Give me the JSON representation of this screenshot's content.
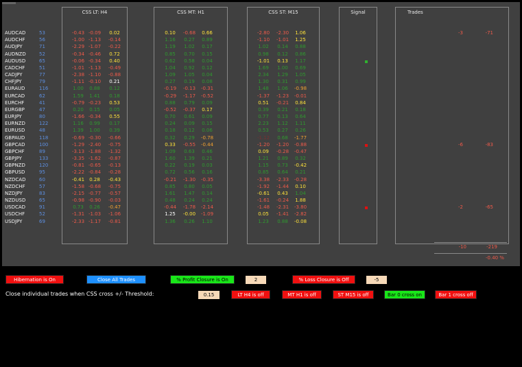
{
  "headers": {
    "lt": "CSS LT:  H4",
    "mt": "CSS MT:  H1",
    "st": "CSS ST:  M15",
    "signal": "Signal",
    "trades": "Trades"
  },
  "colors": {
    "pos": "#b8e85a",
    "neg": "#ef5a4a",
    "dimPos": "#2f9a2f",
    "dimNeg": "#7a2f2f",
    "yellow": "#ffe23a",
    "orange": "#f0a030",
    "white": "#ffffff",
    "signalGreen": "#2fb32f",
    "signalRed": "#e01010"
  },
  "rows": [
    {
      "sym": "AUDCAD",
      "idx": "53",
      "lt": [
        [
          "-0.43",
          "neg"
        ],
        [
          "-0.09",
          "neg"
        ],
        [
          "0.02",
          "yellow"
        ]
      ],
      "mt": [
        [
          "0.10",
          "yellow"
        ],
        [
          "-0.68",
          "neg"
        ],
        [
          "0.66",
          "yellow"
        ]
      ],
      "st": [
        [
          "-2.80",
          "neg"
        ],
        [
          "-2.30",
          "neg"
        ],
        [
          "1.06",
          "yellow"
        ]
      ]
    },
    {
      "sym": "AUDCHF",
      "idx": "56",
      "lt": [
        [
          "-1.00",
          "neg"
        ],
        [
          "-1.13",
          "neg"
        ],
        [
          "-0.14",
          "neg"
        ]
      ],
      "mt": [
        [
          "1.16",
          "dimPos"
        ],
        [
          "0.27",
          "dimPos"
        ],
        [
          "0.89",
          "dimPos"
        ]
      ],
      "st": [
        [
          "-1.10",
          "neg"
        ],
        [
          "-1.01",
          "neg"
        ],
        [
          "1.25",
          "yellow"
        ]
      ]
    },
    {
      "sym": "AUDJPY",
      "idx": "71",
      "lt": [
        [
          "-2.29",
          "neg"
        ],
        [
          "-1.07",
          "neg"
        ],
        [
          "-0.22",
          "neg"
        ]
      ],
      "mt": [
        [
          "1.19",
          "dimPos"
        ],
        [
          "1.02",
          "dimPos"
        ],
        [
          "0.17",
          "dimPos"
        ]
      ],
      "st": [
        [
          "1.02",
          "dimPos"
        ],
        [
          "0.14",
          "dimPos"
        ],
        [
          "0.88",
          "dimPos"
        ]
      ]
    },
    {
      "sym": "AUDNZD",
      "idx": "52",
      "lt": [
        [
          "-0.34",
          "neg"
        ],
        [
          "-0.46",
          "neg"
        ],
        [
          "0.72",
          "yellow"
        ]
      ],
      "mt": [
        [
          "0.85",
          "dimPos"
        ],
        [
          "0.70",
          "dimPos"
        ],
        [
          "0.15",
          "dimPos"
        ]
      ],
      "st": [
        [
          "0.98",
          "dimPos"
        ],
        [
          "0.12",
          "dimPos"
        ],
        [
          "0.86",
          "dimPos"
        ]
      ]
    },
    {
      "sym": "AUDUSD",
      "idx": "65",
      "lt": [
        [
          "-0.06",
          "neg"
        ],
        [
          "-0.34",
          "neg"
        ],
        [
          "0.40",
          "yellow"
        ]
      ],
      "mt": [
        [
          "0.62",
          "dimPos"
        ],
        [
          "0.58",
          "dimPos"
        ],
        [
          "0.04",
          "dimPos"
        ]
      ],
      "st": [
        [
          "-1.01",
          "yellow"
        ],
        [
          "0.13",
          "yellow"
        ],
        [
          "1.17",
          "dimPos"
        ]
      ]
    },
    {
      "sym": "CADCHF",
      "idx": "51",
      "lt": [
        [
          "-1.01",
          "neg"
        ],
        [
          "-1.13",
          "neg"
        ],
        [
          "-0.49",
          "neg"
        ]
      ],
      "mt": [
        [
          "1.04",
          "dimPos"
        ],
        [
          "0.92",
          "dimPos"
        ],
        [
          "0.12",
          "dimPos"
        ]
      ],
      "st": [
        [
          "1.69",
          "dimPos"
        ],
        [
          "1.00",
          "dimPos"
        ],
        [
          "0.69",
          "dimPos"
        ]
      ]
    },
    {
      "sym": "CADJPY",
      "idx": "77",
      "lt": [
        [
          "-2.38",
          "neg"
        ],
        [
          "-1.10",
          "neg"
        ],
        [
          "-0.88",
          "neg"
        ]
      ],
      "mt": [
        [
          "1.09",
          "dimPos"
        ],
        [
          "1.05",
          "dimPos"
        ],
        [
          "0.04",
          "dimPos"
        ]
      ],
      "st": [
        [
          "2.34",
          "dimPos"
        ],
        [
          "1.29",
          "dimPos"
        ],
        [
          "1.05",
          "dimPos"
        ]
      ]
    },
    {
      "sym": "CHFJPY",
      "idx": "79",
      "lt": [
        [
          "-1.11",
          "neg"
        ],
        [
          "-0.10",
          "neg"
        ],
        [
          "0.21",
          "white"
        ]
      ],
      "mt": [
        [
          "0.27",
          "dimPos"
        ],
        [
          "0.19",
          "dimPos"
        ],
        [
          "0.08",
          "dimPos"
        ]
      ],
      "st": [
        [
          "1.30",
          "dimPos"
        ],
        [
          "0.31",
          "dimPos"
        ],
        [
          "0.99",
          "dimPos"
        ]
      ]
    },
    {
      "sym": "EURAUD",
      "idx": "116",
      "lt": [
        [
          "1.00",
          "dimPos"
        ],
        [
          "0.88",
          "dimPos"
        ],
        [
          "0.12",
          "dimPos"
        ]
      ],
      "mt": [
        [
          "-0.19",
          "neg"
        ],
        [
          "-0.13",
          "neg"
        ],
        [
          "-0.31",
          "neg"
        ]
      ],
      "st": [
        [
          "1.48",
          "dimPos"
        ],
        [
          "1.06",
          "dimPos"
        ],
        [
          "-0.98",
          "orange"
        ]
      ]
    },
    {
      "sym": "EURCAD",
      "idx": "62",
      "lt": [
        [
          "1.59",
          "dimPos"
        ],
        [
          "1.41",
          "dimPos"
        ],
        [
          "0.18",
          "dimPos"
        ]
      ],
      "mt": [
        [
          "-0.29",
          "neg"
        ],
        [
          "-1.17",
          "neg"
        ],
        [
          "-0.52",
          "neg"
        ]
      ],
      "st": [
        [
          "-1.37",
          "neg"
        ],
        [
          "-1.23",
          "neg"
        ],
        [
          "-0.01",
          "neg"
        ]
      ]
    },
    {
      "sym": "EURCHF",
      "idx": "41",
      "lt": [
        [
          "-0.79",
          "neg"
        ],
        [
          "-0.23",
          "neg"
        ],
        [
          "0.53",
          "yellow"
        ]
      ],
      "mt": [
        [
          "0.88",
          "dimPos"
        ],
        [
          "0.79",
          "dimPos"
        ],
        [
          "0.09",
          "dimPos"
        ]
      ],
      "st": [
        [
          "0.51",
          "yellow"
        ],
        [
          "-0.21",
          "neg"
        ],
        [
          "0.84",
          "yellow"
        ]
      ]
    },
    {
      "sym": "EURGBP",
      "idx": "47",
      "lt": [
        [
          "0.20",
          "dimPos"
        ],
        [
          "0.15",
          "dimPos"
        ],
        [
          "0.05",
          "dimPos"
        ]
      ],
      "mt": [
        [
          "-0.52",
          "neg"
        ],
        [
          "-0.37",
          "neg"
        ],
        [
          "0.17",
          "yellow"
        ]
      ],
      "st": [
        [
          "0.39",
          "dimPos"
        ],
        [
          "0.21",
          "dimPos"
        ],
        [
          "0.18",
          "dimPos"
        ]
      ]
    },
    {
      "sym": "EURJPY",
      "idx": "80",
      "lt": [
        [
          "-1.66",
          "neg"
        ],
        [
          "-0.34",
          "neg"
        ],
        [
          "0.55",
          "yellow"
        ]
      ],
      "mt": [
        [
          "0.70",
          "dimPos"
        ],
        [
          "0.61",
          "dimPos"
        ],
        [
          "0.09",
          "dimPos"
        ]
      ],
      "st": [
        [
          "0.77",
          "dimPos"
        ],
        [
          "0.13",
          "dimPos"
        ],
        [
          "0.64",
          "dimPos"
        ]
      ]
    },
    {
      "sym": "EURNZD",
      "idx": "122",
      "lt": [
        [
          "1.16",
          "dimPos"
        ],
        [
          "0.99",
          "dimPos"
        ],
        [
          "0.17",
          "dimPos"
        ]
      ],
      "mt": [
        [
          "0.24",
          "dimPos"
        ],
        [
          "0.09",
          "dimPos"
        ],
        [
          "0.15",
          "dimPos"
        ]
      ],
      "st": [
        [
          "2.23",
          "dimPos"
        ],
        [
          "1.12",
          "dimPos"
        ],
        [
          "1.11",
          "dimPos"
        ]
      ]
    },
    {
      "sym": "EURUSD",
      "idx": "48",
      "lt": [
        [
          "1.39",
          "dimPos"
        ],
        [
          "1.00",
          "dimPos"
        ],
        [
          "0.39",
          "dimPos"
        ]
      ],
      "mt": [
        [
          "0.18",
          "dimPos"
        ],
        [
          "0.12",
          "dimPos"
        ],
        [
          "0.06",
          "dimPos"
        ]
      ],
      "st": [
        [
          "0.53",
          "dimPos"
        ],
        [
          "0.27",
          "dimPos"
        ],
        [
          "0.26",
          "dimPos"
        ]
      ]
    },
    {
      "sym": "GBPAUD",
      "idx": "118",
      "lt": [
        [
          "-0.69",
          "neg"
        ],
        [
          "-0.30",
          "neg"
        ],
        [
          "-0.66",
          "neg"
        ]
      ],
      "mt": [
        [
          "0.32",
          "dimPos"
        ],
        [
          "0.29",
          "dimPos"
        ],
        [
          "-0.78",
          "orange"
        ]
      ],
      "st": [
        [
          "-1.12",
          "dimNeg"
        ],
        [
          "0.68",
          "dimPos"
        ],
        [
          "-1.77",
          "orange"
        ]
      ]
    },
    {
      "sym": "GBPCAD",
      "idx": "100",
      "lt": [
        [
          "-1.29",
          "neg"
        ],
        [
          "-2.40",
          "neg"
        ],
        [
          "-0.75",
          "neg"
        ]
      ],
      "mt": [
        [
          "0.33",
          "yellow"
        ],
        [
          "-0.55",
          "neg"
        ],
        [
          "-0.44",
          "orange"
        ]
      ],
      "st": [
        [
          "-1.20",
          "neg"
        ],
        [
          "-1.20",
          "neg"
        ],
        [
          "-0.88",
          "neg"
        ]
      ]
    },
    {
      "sym": "GBPCHF",
      "idx": "89",
      "lt": [
        [
          "-3.13",
          "neg"
        ],
        [
          "-1.88",
          "neg"
        ],
        [
          "-1.32",
          "neg"
        ]
      ],
      "mt": [
        [
          "1.09",
          "dimPos"
        ],
        [
          "0.63",
          "dimPos"
        ],
        [
          "0.46",
          "dimPos"
        ]
      ],
      "st": [
        [
          "0.09",
          "yellow"
        ],
        [
          "-0.28",
          "neg"
        ],
        [
          "-0.47",
          "neg"
        ]
      ]
    },
    {
      "sym": "GBPJPY",
      "idx": "133",
      "lt": [
        [
          "-3.35",
          "neg"
        ],
        [
          "-1.62",
          "neg"
        ],
        [
          "-0.87",
          "neg"
        ]
      ],
      "mt": [
        [
          "1.60",
          "dimPos"
        ],
        [
          "1.39",
          "dimPos"
        ],
        [
          "0.21",
          "dimPos"
        ]
      ],
      "st": [
        [
          "1.21",
          "dimPos"
        ],
        [
          "0.89",
          "dimPos"
        ],
        [
          "0.32",
          "dimPos"
        ]
      ]
    },
    {
      "sym": "GBPNZD",
      "idx": "120",
      "lt": [
        [
          "-0.81",
          "neg"
        ],
        [
          "-0.65",
          "neg"
        ],
        [
          "-0.13",
          "neg"
        ]
      ],
      "mt": [
        [
          "0.22",
          "dimPos"
        ],
        [
          "0.19",
          "dimPos"
        ],
        [
          "0.03",
          "dimPos"
        ]
      ],
      "st": [
        [
          "1.15",
          "dimPos"
        ],
        [
          "0.73",
          "dimPos"
        ],
        [
          "-0.42",
          "yellow"
        ]
      ]
    },
    {
      "sym": "GBPUSD",
      "idx": "95",
      "lt": [
        [
          "-2.22",
          "neg"
        ],
        [
          "-0.84",
          "neg"
        ],
        [
          "-0.28",
          "neg"
        ]
      ],
      "mt": [
        [
          "0.72",
          "dimPos"
        ],
        [
          "0.56",
          "dimPos"
        ],
        [
          "0.16",
          "dimPos"
        ]
      ],
      "st": [
        [
          "0.85",
          "dimPos"
        ],
        [
          "0.64",
          "dimPos"
        ],
        [
          "0.21",
          "dimPos"
        ]
      ]
    },
    {
      "sym": "NZDCAD",
      "idx": "60",
      "lt": [
        [
          "-0.41",
          "yellow"
        ],
        [
          "0.28",
          "yellow"
        ],
        [
          "-0.43",
          "yellow"
        ]
      ],
      "mt": [
        [
          "-0.21",
          "neg"
        ],
        [
          "-1.30",
          "neg"
        ],
        [
          "-0.35",
          "neg"
        ]
      ],
      "st": [
        [
          "-3.38",
          "neg"
        ],
        [
          "-2.33",
          "neg"
        ],
        [
          "-0.28",
          "neg"
        ]
      ]
    },
    {
      "sym": "NZDCHF",
      "idx": "57",
      "lt": [
        [
          "-1.58",
          "neg"
        ],
        [
          "-0.68",
          "neg"
        ],
        [
          "-0.75",
          "neg"
        ]
      ],
      "mt": [
        [
          "0.85",
          "dimPos"
        ],
        [
          "0.80",
          "dimPos"
        ],
        [
          "0.05",
          "dimPos"
        ]
      ],
      "st": [
        [
          "-1.92",
          "neg"
        ],
        [
          "-1.44",
          "neg"
        ],
        [
          "0.10",
          "yellow"
        ]
      ]
    },
    {
      "sym": "NZDJPY",
      "idx": "83",
      "lt": [
        [
          "-2.15",
          "neg"
        ],
        [
          "-0.77",
          "neg"
        ],
        [
          "-0.57",
          "neg"
        ]
      ],
      "mt": [
        [
          "1.61",
          "dimPos"
        ],
        [
          "1.47",
          "dimPos"
        ],
        [
          "0.14",
          "dimPos"
        ]
      ],
      "st": [
        [
          "-0.61",
          "yellow"
        ],
        [
          "0.43",
          "yellow"
        ],
        [
          "1.04",
          "dimPos"
        ]
      ]
    },
    {
      "sym": "NZDUSD",
      "idx": "65",
      "lt": [
        [
          "-0.98",
          "neg"
        ],
        [
          "-0.90",
          "neg"
        ],
        [
          "-0.03",
          "neg"
        ]
      ],
      "mt": [
        [
          "0.48",
          "dimPos"
        ],
        [
          "0.24",
          "dimPos"
        ],
        [
          "0.24",
          "dimPos"
        ]
      ],
      "st": [
        [
          "-1.61",
          "neg"
        ],
        [
          "-0.24",
          "neg"
        ],
        [
          "1.88",
          "yellow"
        ]
      ]
    },
    {
      "sym": "USDCAD",
      "idx": "91",
      "lt": [
        [
          "0.73",
          "dimPos"
        ],
        [
          "0.26",
          "dimPos"
        ],
        [
          "-0.47",
          "orange"
        ]
      ],
      "mt": [
        [
          "-0.44",
          "neg"
        ],
        [
          "-1.78",
          "neg"
        ],
        [
          "-2.14",
          "neg"
        ]
      ],
      "st": [
        [
          "-1.48",
          "neg"
        ],
        [
          "-2.31",
          "neg"
        ],
        [
          "-3.80",
          "neg"
        ]
      ]
    },
    {
      "sym": "USDCHF",
      "idx": "52",
      "lt": [
        [
          "-1.31",
          "neg"
        ],
        [
          "-1.03",
          "neg"
        ],
        [
          "-1.06",
          "neg"
        ]
      ],
      "mt": [
        [
          "1.25",
          "white"
        ],
        [
          "-0.00",
          "yellow"
        ],
        [
          "-1.09",
          "neg"
        ]
      ],
      "st": [
        [
          "0.05",
          "yellow"
        ],
        [
          "-1.41",
          "neg"
        ],
        [
          "-2.82",
          "neg"
        ]
      ]
    },
    {
      "sym": "USDJPY",
      "idx": "69",
      "lt": [
        [
          "-2.33",
          "neg"
        ],
        [
          "-1.17",
          "neg"
        ],
        [
          "-0.81",
          "neg"
        ]
      ],
      "mt": [
        [
          "1.36",
          "dimPos"
        ],
        [
          "0.26",
          "dimPos"
        ],
        [
          "1.10",
          "dimPos"
        ]
      ],
      "st": [
        [
          "1.23",
          "dimPos"
        ],
        [
          "0.88",
          "dimPos"
        ],
        [
          "-0.08",
          "yellow"
        ]
      ]
    }
  ],
  "signals": [
    {
      "row": 4,
      "color": "signalGreen"
    },
    {
      "row": 16,
      "color": "signalRed"
    },
    {
      "row": 25,
      "color": "signalRed"
    }
  ],
  "trades": [
    {
      "row": 0,
      "a": "-3",
      "b": "-71"
    },
    {
      "row": 16,
      "a": "-6",
      "b": "-83"
    },
    {
      "row": 25,
      "a": "-2",
      "b": "-65"
    }
  ],
  "totals": {
    "a": "-10",
    "b": "-219",
    "pct": "-0.40 %"
  },
  "controls": {
    "hibernation": "Hibernation is On",
    "closeAll": "Close All Trades",
    "profitClosure": "% Profit Closure is On",
    "profitValue": "2",
    "lossClosure": "% Loss Closure is Off",
    "lossValue": "-5",
    "closeIndividualLabel": "Close individual trades when CSS cross +/- Threshold:",
    "threshold": "0.15",
    "ltH4": "LT  H4 is off",
    "mtH1": "MT  H1 is off",
    "stM15": "ST  M15 is off",
    "bar0": "Bar 0 cross on",
    "bar1": "Bar 1 cross off"
  }
}
